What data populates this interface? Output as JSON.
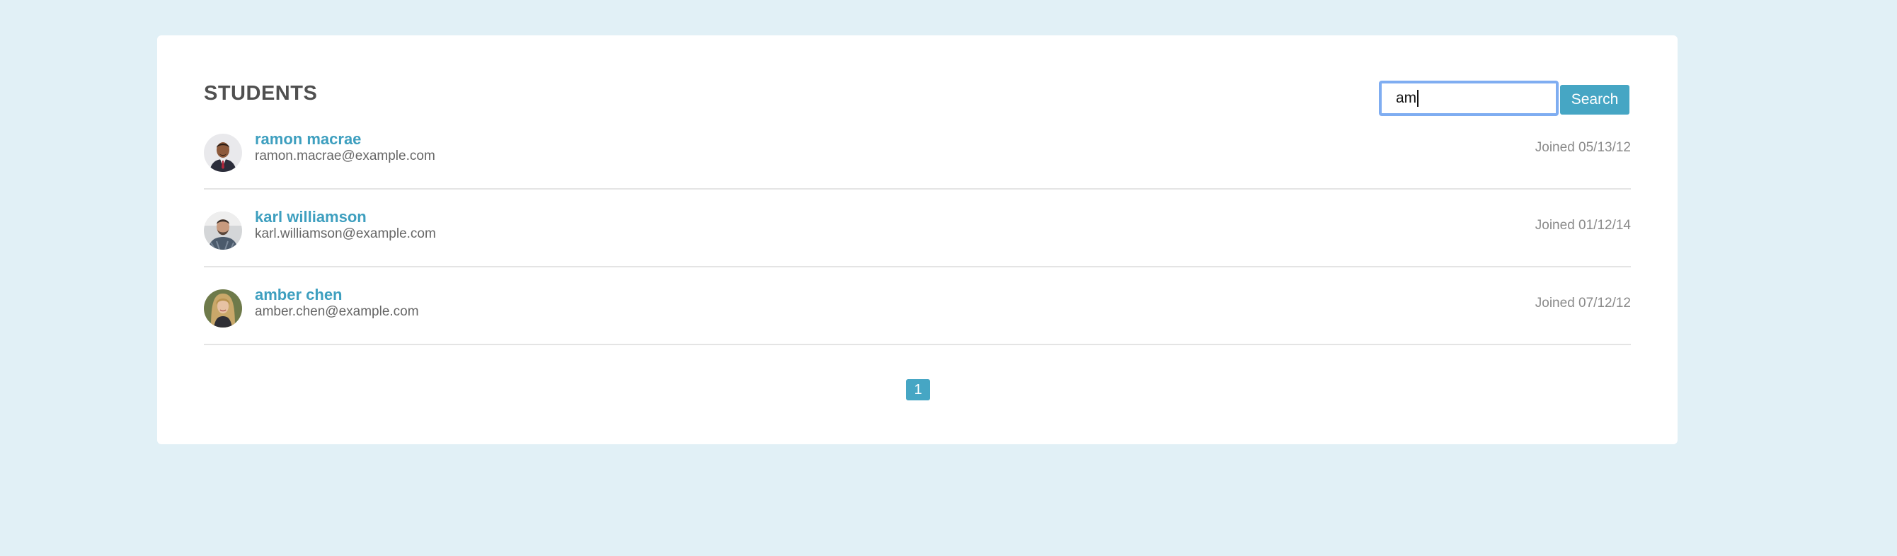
{
  "page": {
    "title": "STUDENTS"
  },
  "search": {
    "value": "am",
    "button_label": "Search"
  },
  "students": [
    {
      "name": "ramon macrae",
      "email": "ramon.macrae@example.com",
      "joined": "Joined 05/13/12"
    },
    {
      "name": "karl williamson",
      "email": "karl.williamson@example.com",
      "joined": "Joined 01/12/14"
    },
    {
      "name": "amber chen",
      "email": "amber.chen@example.com",
      "joined": "Joined 07/12/12"
    }
  ],
  "pagination": {
    "current_page": "1"
  },
  "colors": {
    "background": "#e1f0f6",
    "accent": "#46a6c4",
    "link": "#3e9fbf",
    "focus_ring": "#7fadf1"
  }
}
